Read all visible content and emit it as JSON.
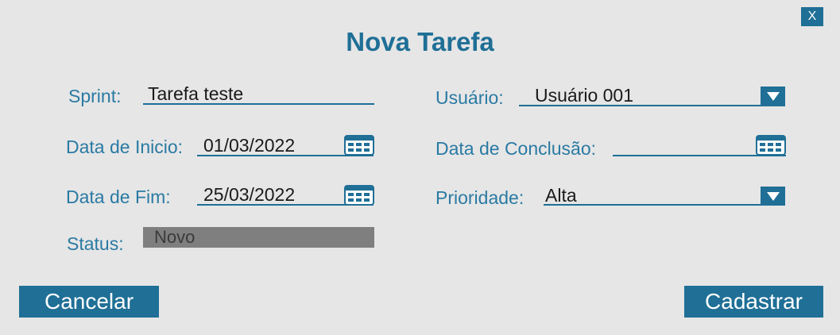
{
  "dialog": {
    "title": "Nova Tarefa",
    "close_label": "X"
  },
  "form": {
    "sprint": {
      "label": "Sprint:",
      "value": "Tarefa teste"
    },
    "usuario": {
      "label": "Usuário:",
      "value": "Usuário 001"
    },
    "data_inicio": {
      "label": "Data de Inicio:",
      "value": "01/03/2022"
    },
    "data_conclusao": {
      "label": "Data de Conclusão:",
      "value": ""
    },
    "data_fim": {
      "label": "Data de Fim:",
      "value": "25/03/2022"
    },
    "prioridade": {
      "label": "Prioridade:",
      "value": "Alta"
    },
    "status": {
      "label": "Status:",
      "value": "Novo"
    }
  },
  "buttons": {
    "cancel_label": "Cancelar",
    "submit_label": "Cadastrar"
  },
  "colors": {
    "accent": "#1f6f96",
    "label": "#2a7aa3",
    "background": "#e6e6e6",
    "status_box": "#7f7f7f"
  },
  "icons": {
    "calendar": "calendar-icon",
    "dropdown": "chevron-down-icon",
    "close": "close-icon"
  }
}
